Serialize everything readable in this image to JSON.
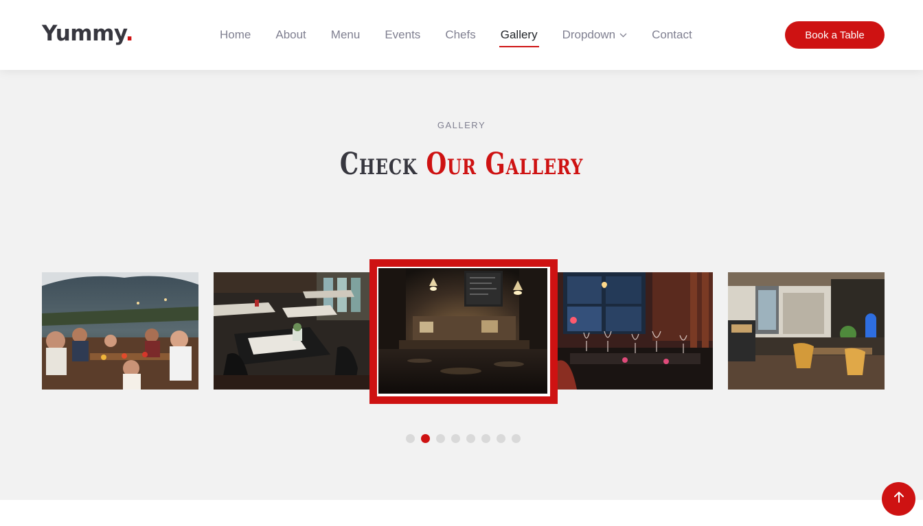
{
  "brand": {
    "name": "Yummy",
    "dot": ".",
    "accent_color": "#ce1212"
  },
  "nav": {
    "items": [
      {
        "label": "Home"
      },
      {
        "label": "About"
      },
      {
        "label": "Menu"
      },
      {
        "label": "Events"
      },
      {
        "label": "Chefs"
      },
      {
        "label": "Gallery",
        "active": true
      },
      {
        "label": "Dropdown",
        "has_dropdown": true
      },
      {
        "label": "Contact"
      }
    ]
  },
  "header": {
    "cta_label": "Book a Table"
  },
  "gallery": {
    "subtitle": "GALLERY",
    "title_plain": "Check",
    "title_accent": "Our Gallery",
    "slides": [
      {
        "name": "outdoor-dinner-party-photo"
      },
      {
        "name": "dining-tables-photo"
      },
      {
        "name": "restaurant-interior-blurred-photo",
        "active": true
      },
      {
        "name": "wine-glasses-table-photo"
      },
      {
        "name": "bar-counter-photo"
      }
    ],
    "pagination": {
      "count": 8,
      "active_index": 1
    }
  },
  "icons": {
    "dropdown": "chevron-down-icon",
    "scroll_top": "arrow-up-icon"
  }
}
